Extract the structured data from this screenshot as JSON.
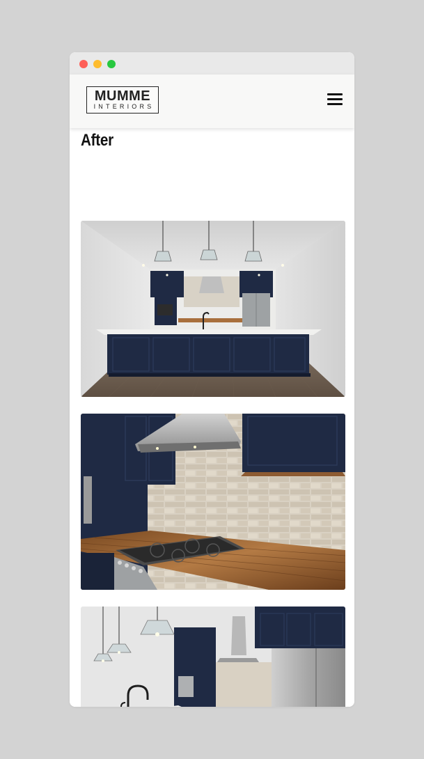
{
  "window": {
    "controls": [
      "close",
      "minimize",
      "maximize"
    ],
    "colors": {
      "close": "#fe5f57",
      "minimize": "#febc2e",
      "maximize": "#28c840"
    }
  },
  "header": {
    "logo_main": "MUMME",
    "logo_sub": "INTERIORS",
    "menu_icon": "hamburger-menu-icon"
  },
  "gallery": {
    "title": "After",
    "images": [
      {
        "subject": "kitchen-island-wide-view"
      },
      {
        "subject": "range-hood-and-stove"
      },
      {
        "subject": "island-sink-and-refrigerator"
      }
    ]
  },
  "palette": {
    "navy_cabinet": "#1f2a44",
    "page_bg": "#d3d3d3",
    "header_bg": "#f8f8f7"
  }
}
